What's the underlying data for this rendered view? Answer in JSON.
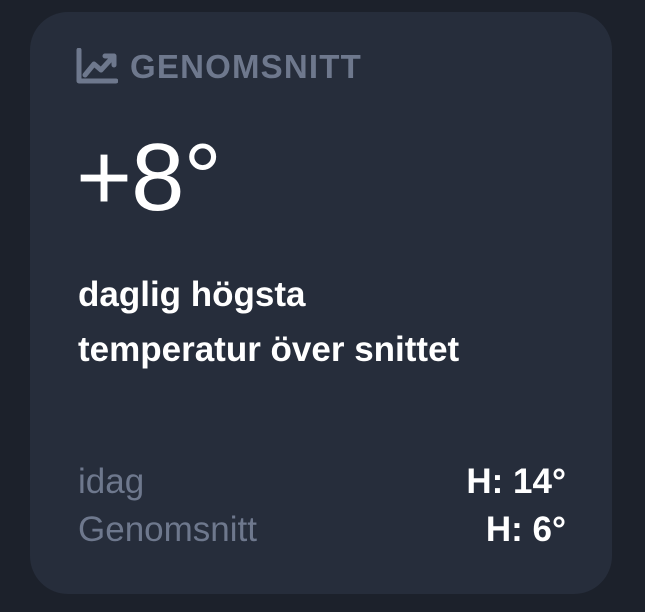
{
  "widget": {
    "header": {
      "icon": "chart-line-icon",
      "label": "GENOMSNITT"
    },
    "value": "+8°",
    "description_lines": [
      "daglig högsta",
      "temperatur över snittet"
    ],
    "rows": [
      {
        "label": "idag",
        "value": "H: 14°"
      },
      {
        "label": "Genomsnitt",
        "value": "H: 6°"
      }
    ]
  },
  "colors": {
    "background": "#1c212b",
    "card": "#262d3b",
    "muted_text": "#6e788d",
    "primary_text": "#ffffff"
  }
}
